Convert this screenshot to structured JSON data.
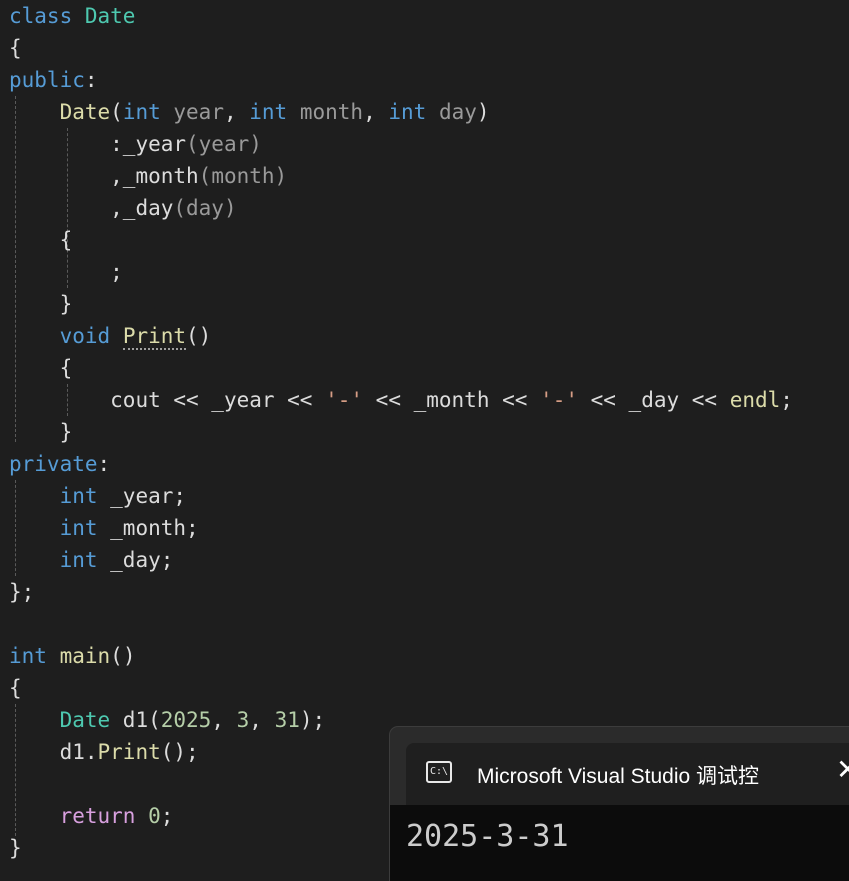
{
  "editor": {
    "lines": {
      "l1": {
        "kw_class": "class",
        "class_name": "Date"
      },
      "l2": {
        "brace": "{"
      },
      "l3": {
        "access": "public",
        "colon": ":"
      },
      "l4": {
        "ctor": "Date",
        "p1": "(",
        "int1": "int",
        "year": " year",
        "sep1": ", ",
        "int2": "int",
        "month": " month",
        "sep2": ", ",
        "int3": "int",
        "day": " day",
        "p2": ")"
      },
      "l5": {
        "init": ":_year",
        "arg": "(year)"
      },
      "l6": {
        "init": ",_month",
        "arg": "(month)"
      },
      "l7": {
        "init": ",_day",
        "arg": "(day)"
      },
      "l8": {
        "brace": "{"
      },
      "l9": {
        "stmt": ";"
      },
      "l10": {
        "brace": "}"
      },
      "l11": {
        "kw_void": "void",
        "fn": "Print",
        "parens": "()"
      },
      "l12": {
        "brace": "{"
      },
      "l13": {
        "cout": "cout << _year << ",
        "s1": "'-'",
        "m1": " << _month << ",
        "s2": "'-'",
        "m2": " << _day << ",
        "endl": "endl",
        "semi": ";"
      },
      "l14": {
        "brace": "}"
      },
      "l15": {
        "access": "private",
        "colon": ":"
      },
      "l16": {
        "kw_int": "int",
        "rest": " _year;"
      },
      "l17": {
        "kw_int": "int",
        "rest": " _month;"
      },
      "l18": {
        "kw_int": "int",
        "rest": " _day;"
      },
      "l19": {
        "end": "};"
      },
      "l21": {
        "kw_int": "int",
        "fn": "main",
        "parens": "()"
      },
      "l22": {
        "brace": "{"
      },
      "l23": {
        "type": "Date",
        "var": " d1(",
        "n1": "2025",
        "c1": ", ",
        "n2": "3",
        "c2": ", ",
        "n3": "31",
        "end": ");"
      },
      "l24": {
        "obj": "d1.",
        "fn": "Print",
        "end": "();"
      },
      "l26": {
        "kw_return": "return",
        "sp": " ",
        "num": "0",
        "semi": ";"
      },
      "l27": {
        "brace": "}"
      }
    }
  },
  "console": {
    "icon_text": "C:\\",
    "icon": "console-icon",
    "title": "Microsoft Visual Studio 调试控",
    "close": "✕",
    "close_icon": "close-icon",
    "output": "2025-3-31"
  },
  "colors": {
    "background": "#1e1e1e",
    "keyword": "#569cd6",
    "type": "#4ec9b0",
    "function": "#dcdcaa",
    "parameter": "#9a9a9a",
    "number": "#b5cea8",
    "string": "#d69d85",
    "control": "#d8a0df"
  }
}
